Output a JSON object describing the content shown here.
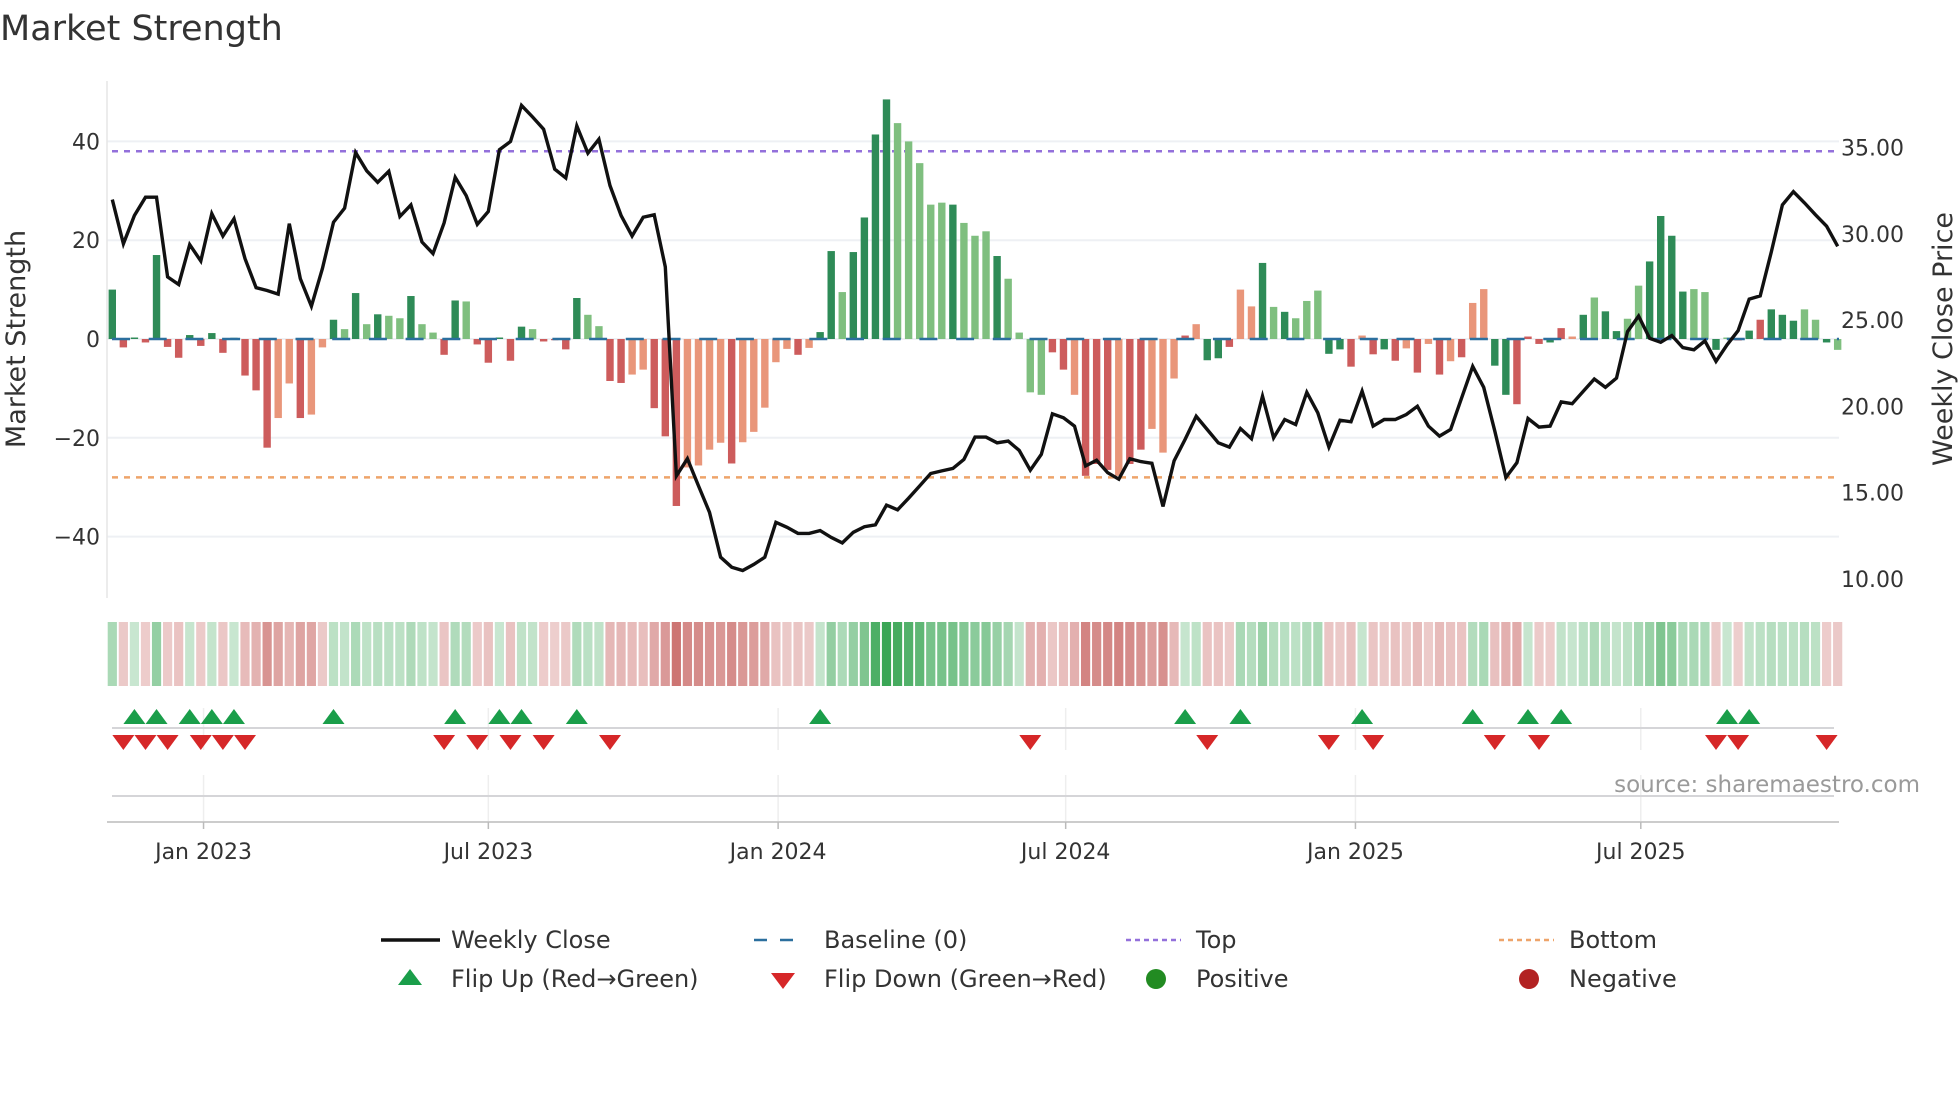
{
  "chart_data": {
    "type": "bar+line",
    "title": "Market Strength",
    "ylabel_left": "Market Strength",
    "ylabel_right": "Weekly Close Price",
    "source": "source: sharemaestro.com",
    "ylim_left": [
      -52,
      52
    ],
    "ylim_right": [
      8.5,
      38.5
    ],
    "left_ticks": [
      {
        "value": 40,
        "label": "40"
      },
      {
        "value": 20,
        "label": "20"
      },
      {
        "value": 0,
        "label": "0"
      },
      {
        "value": -20,
        "label": "−20"
      },
      {
        "value": -40,
        "label": "−40"
      }
    ],
    "right_ticks": [
      {
        "value": 35,
        "label": "35.00"
      },
      {
        "value": 30,
        "label": "30.00"
      },
      {
        "value": 25,
        "label": "25.00"
      },
      {
        "value": 20,
        "label": "20.00"
      },
      {
        "value": 15,
        "label": "15.00"
      },
      {
        "value": 10,
        "label": "10.00"
      }
    ],
    "x_ticks": [
      {
        "week": 8.25,
        "label": "Jan 2023"
      },
      {
        "week": 34.0,
        "label": "Jul 2023"
      },
      {
        "week": 60.2,
        "label": "Jan 2024"
      },
      {
        "week": 86.2,
        "label": "Jul 2024"
      },
      {
        "week": 112.4,
        "label": "Jan 2025"
      },
      {
        "week": 138.2,
        "label": "Jul 2025"
      }
    ],
    "top_level": 38,
    "bottom_level": -28,
    "baseline": 0,
    "strength": [
      10,
      -1.7,
      0.3,
      -0.7,
      17,
      -1.6,
      -3.8,
      0.8,
      -1.4,
      1.2,
      -2.8,
      0.2,
      -7.4,
      -10.4,
      -22,
      -16,
      -9,
      -16,
      -15.3,
      -1.7,
      3.9,
      2,
      9.3,
      3,
      5,
      4.7,
      4.2,
      8.7,
      3,
      1.3,
      -3.2,
      7.8,
      7.6,
      -1.1,
      -4.8,
      0.3,
      -4.4,
      2.5,
      2,
      -0.5,
      -0.2,
      -2.1,
      8.3,
      4.9,
      2.6,
      -8.5,
      -8.9,
      -7.2,
      -6.2,
      -14,
      -19.7,
      -33.8,
      -26,
      -25.6,
      -22.4,
      -21,
      -25.2,
      -20.9,
      -18.8,
      -13.9,
      -4.7,
      -2,
      -3.2,
      -1.8,
      1.4,
      17.8,
      9.5,
      17.6,
      24.6,
      41.4,
      48.5,
      43.7,
      40,
      35.6,
      27.2,
      27.6,
      27.2,
      23.5,
      20.9,
      21.8,
      16.8,
      12.2,
      1.3,
      -10.8,
      -11.3,
      -2.7,
      -6.2,
      -11.3,
      -27.7,
      -25.3,
      -26.5,
      -27.7,
      -25.3,
      -22.4,
      -18.2,
      -23,
      -8,
      0.7,
      3,
      -4.3,
      -3.9,
      -1.6,
      10,
      6.6,
      15.4,
      6.5,
      5.5,
      4.2,
      7.7,
      9.8,
      -3,
      -2.1,
      -5.6,
      0.7,
      -3.1,
      -2.1,
      -4.4,
      -1.9,
      -6.8,
      -1,
      -7.2,
      -4.5,
      -3.7,
      7.3,
      10.1,
      -5.4,
      -11.3,
      -13.2,
      0.5,
      -1,
      -0.7,
      2.2,
      0.5,
      4.9,
      8.4,
      5.6,
      1.6,
      4.1,
      10.8,
      15.7,
      24.9,
      20.9,
      9.6,
      10.1,
      9.5,
      -2.2,
      0.3,
      -0.3,
      1.7,
      3.9,
      6,
      4.9,
      3.7,
      6,
      3.9,
      -0.7,
      -2.2
    ],
    "strength_kind": "GRGRGRRGRGRGRRRrrRrrGgGgGggGggRGgRRGRGgR RRGggRRrrRRRrrrrRrrrrrRrGGgGGGGgggggGgggG ggggRRrRRRrRRrrrRrGGRrrGgGgggGGRrRGRrRrRr RrrGGRRRGRrGgGGggGGGGggGgRGRGGGggGgRR",
    "weekly_close": [
      31.98,
      29.42,
      31.06,
      32.12,
      32.12,
      27.5,
      27.06,
      29.37,
      28.42,
      31.17,
      29.87,
      30.87,
      28.56,
      26.87,
      26.71,
      26.5,
      30.58,
      27.4,
      25.8,
      27.98,
      30.67,
      31.48,
      34.71,
      33.65,
      32.98,
      33.62,
      31.0,
      31.67,
      29.52,
      28.85,
      30.63,
      33.27,
      32.21,
      30.54,
      31.29,
      34.87,
      35.35,
      37.44,
      36.77,
      36.06,
      33.75,
      33.23,
      36.25,
      34.67,
      35.48,
      32.79,
      31.06,
      29.87,
      30.96,
      31.1,
      28.08,
      15.96,
      16.96,
      15.38,
      13.85,
      11.25,
      10.67,
      10.48,
      10.83,
      11.25,
      13.27,
      12.98,
      12.63,
      12.63,
      12.79,
      12.4,
      12.08,
      12.69,
      13.02,
      13.13,
      14.27,
      14.0,
      14.67,
      15.38,
      16.1,
      16.25,
      16.4,
      16.92,
      18.21,
      18.21,
      17.88,
      17.98,
      17.44,
      16.29,
      17.21,
      19.56,
      19.33,
      18.85,
      16.54,
      16.87,
      16.15,
      15.77,
      16.96,
      16.79,
      16.69,
      14.19,
      16.83,
      18.08,
      19.42,
      18.65,
      17.88,
      17.63,
      18.71,
      18.12,
      20.58,
      18.17,
      19.23,
      18.94,
      20.81,
      19.62,
      17.63,
      19.19,
      19.1,
      20.87,
      18.85,
      19.23,
      19.23,
      19.52,
      20.0,
      18.85,
      18.27,
      18.65,
      20.48,
      22.31,
      21.1,
      18.56,
      15.87,
      16.73,
      19.29,
      18.79,
      18.85,
      20.25,
      20.15,
      20.87,
      21.58,
      21.1,
      21.63,
      24.33,
      25.23,
      23.94,
      23.71,
      24.1,
      23.4,
      23.27,
      23.79,
      22.6,
      23.56,
      24.38,
      26.21,
      26.4,
      28.94,
      31.67,
      32.44,
      31.79,
      31.1,
      30.44,
      29.27
    ],
    "flip_up_weeks": [
      2,
      4,
      7,
      9,
      11,
      20,
      31,
      35,
      37,
      42,
      64,
      97,
      102,
      113,
      123,
      128,
      131,
      146,
      148
    ],
    "flip_down_weeks": [
      1,
      3,
      5,
      8,
      10,
      12,
      30,
      33,
      36,
      39,
      45,
      83,
      99,
      110,
      114,
      125,
      129,
      145,
      147,
      155
    ],
    "legend": [
      {
        "key": "weekly_close",
        "label": "Weekly Close"
      },
      {
        "key": "baseline",
        "label": "Baseline (0)"
      },
      {
        "key": "top",
        "label": "Top"
      },
      {
        "key": "bottom",
        "label": "Bottom"
      },
      {
        "key": "flip_up",
        "label": "Flip Up (Red→Green)"
      },
      {
        "key": "flip_down",
        "label": "Flip Down (Green→Red)"
      },
      {
        "key": "positive",
        "label": "Positive"
      },
      {
        "key": "negative",
        "label": "Negative"
      }
    ],
    "legend_placement": "bottom",
    "grid": true
  },
  "colors": {
    "strong_pos": "#2e8b57",
    "weak_pos": "#7fbf7f",
    "strong_neg": "#cd5c5c",
    "weak_neg": "#e9967a",
    "line": "#111111",
    "baseline": "#2b6f9e",
    "top": "#9370db",
    "bottom": "#eea46a",
    "flip_up": "#1a9e4a",
    "flip_down": "#d62728",
    "positive": "#228b22",
    "negative": "#b22222",
    "strip_pos": "#3aa655",
    "strip_neg": "#c0504d"
  }
}
